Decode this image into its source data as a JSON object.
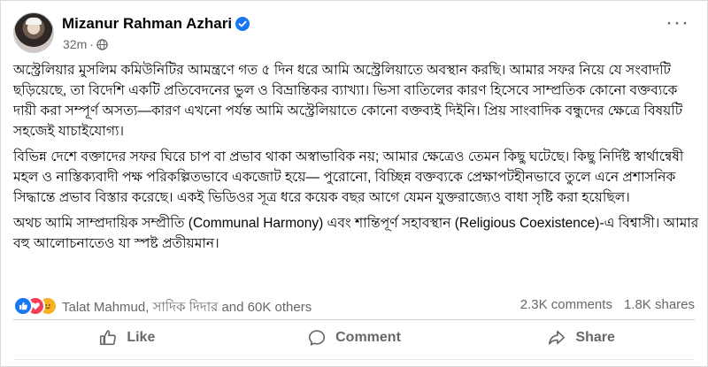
{
  "post": {
    "author": "Mizanur Rahman Azhari",
    "time": "32m",
    "paragraphs": [
      "অস্ট্রেলিয়ার মুসলিম কমিউনিটির আমন্ত্রণে গত ৫ দিন ধরে আমি অস্ট্রেলিয়াতে অবস্থান করছি। আমার সফর নিয়ে যে সংবাদটি ছড়িয়েছে, তা বিদেশি একটি প্রতিবেদনের ভুল ও বিভ্রান্তিকর ব্যাখ্যা। ভিসা বাতিলের কারণ হিসেবে সাম্প্রতিক কোনো বক্তব্যকে দায়ী করা সম্পূর্ণ অসত্য—কারণ এখনো পর্যন্ত আমি অস্ট্রেলিয়াতে কোনো বক্তব্যই দিইনি। প্রিয় সাংবাদিক বন্ধুদের ক্ষেত্রে বিষয়টি সহজেই যাচাইযোগ্য।",
      "বিভিন্ন দেশে বক্তাদের সফর ঘিরে চাপ বা প্রভাব থাকা অস্বাভাবিক নয়; আমার ক্ষেত্রেও তেমন কিছু ঘটেছে। কিছু নির্দিষ্ট স্বার্থান্বেষী মহল ও নাস্তিক্যবাদী পক্ষ পরিকল্পিতভাবে একজোট হয়ে— পুরোনো, বিচ্ছিন্ন বক্তব্যকে প্রেক্ষাপটহীনভাবে তুলে এনে প্রশাসনিক সিদ্ধান্তে প্রভাব বিস্তার করেছে। একই ভিডিওর সূত্র ধরে কয়েক বছর আগে যেমন যুক্তরাজ্যেও বাধা সৃষ্টি করা হয়েছিল।",
      "অথচ আমি সাম্প্রদায়িক সম্প্রীতি (Communal Harmony) এবং শান্তিপূর্ণ সহাবস্থান (Religious Coexistence)-এ বিশ্বাসী। আমার বহু আলোচনাতেও যা স্পষ্ট প্রতীয়মান।"
    ]
  },
  "reactions": {
    "names": "Talat Mahmud, সাদিক দিদার and 60K others",
    "comments": "2.3K comments",
    "shares": "1.8K shares"
  },
  "actions": {
    "like": "Like",
    "comment": "Comment",
    "share": "Share"
  },
  "colors": {
    "verified": "#1877f2",
    "like": "#1877f2",
    "love": "#f33e58",
    "care": "#f7b125",
    "muted": "#65676b"
  },
  "icons": [
    "verified-badge-icon",
    "globe-icon",
    "more-icon",
    "like-reaction-icon",
    "love-reaction-icon",
    "care-reaction-icon",
    "thumbs-up-icon",
    "comment-bubble-icon",
    "share-arrow-icon"
  ]
}
